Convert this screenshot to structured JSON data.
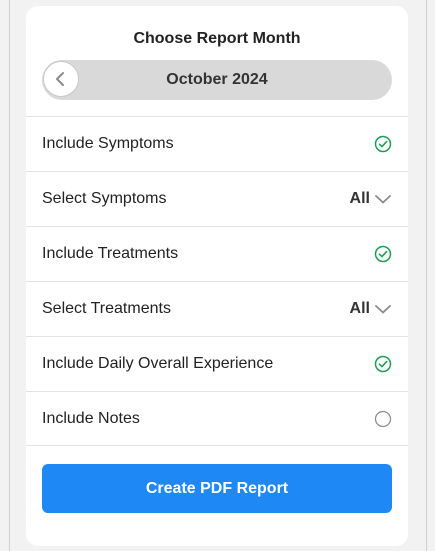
{
  "report": {
    "title": "Choose Report Month",
    "month_label": "October 2024"
  },
  "options": [
    {
      "label": "Include Symptoms",
      "type": "checkbox",
      "checked": true
    },
    {
      "label": "Select Symptoms",
      "type": "select",
      "value": "All"
    },
    {
      "label": "Include Treatments",
      "type": "checkbox",
      "checked": true
    },
    {
      "label": "Select Treatments",
      "type": "select",
      "value": "All"
    },
    {
      "label": "Include Daily Overall Experience",
      "type": "checkbox",
      "checked": true
    },
    {
      "label": "Include Notes",
      "type": "checkbox",
      "checked": false
    }
  ],
  "actions": {
    "create_label": "Create PDF Report"
  },
  "icons": {
    "prev": "chevron-left-icon",
    "checked": "check-circle-icon",
    "unchecked": "empty-circle-icon",
    "dropdown": "chevron-down-icon"
  },
  "colors": {
    "accent": "#1e88f5",
    "check_green": "#1f9d55",
    "unchecked_gray": "#8e8e8e"
  }
}
